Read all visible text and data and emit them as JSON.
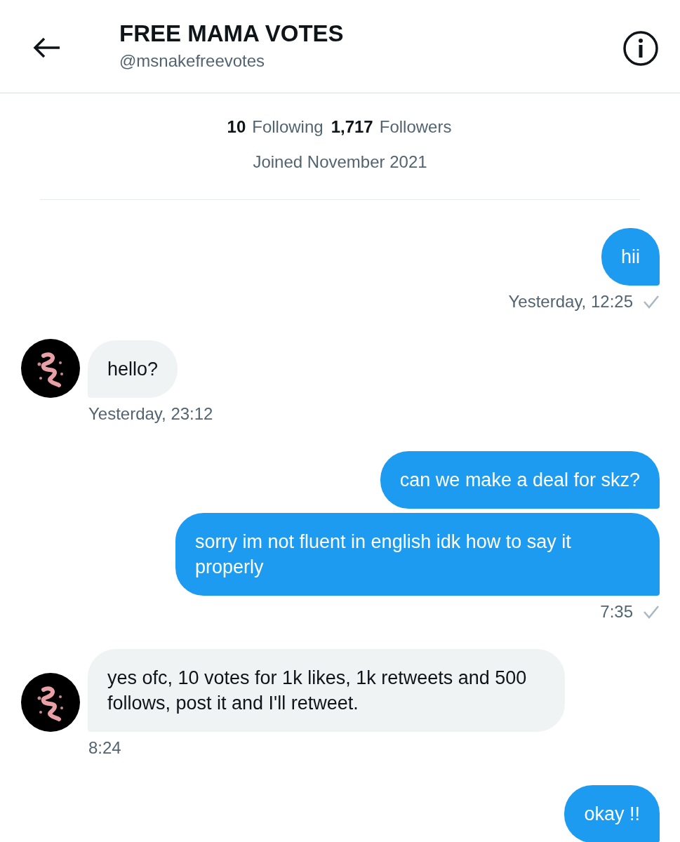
{
  "header": {
    "title": "FREE MAMA VOTES",
    "handle": "@msnakefreevotes"
  },
  "profile": {
    "following_count": "10",
    "following_label": "Following",
    "followers_count": "1,717",
    "followers_label": "Followers",
    "joined": "Joined November 2021"
  },
  "messages": [
    {
      "kind": "sent",
      "bubbles": [
        "hii"
      ],
      "time": "Yesterday, 12:25",
      "delivered": true
    },
    {
      "kind": "received",
      "bubbles": [
        "hello?"
      ],
      "time": "Yesterday, 23:12"
    },
    {
      "kind": "sent",
      "bubbles": [
        "can we make a deal for skz?",
        "sorry im not fluent in english idk how to say it properly"
      ],
      "time": "7:35",
      "delivered": true
    },
    {
      "kind": "received",
      "bubbles": [
        "yes ofc, 10 votes for 1k likes, 1k retweets and 500 follows, post it and I'll retweet."
      ],
      "time": "8:24"
    },
    {
      "kind": "sent",
      "bubbles": [
        "okay !!"
      ]
    }
  ]
}
